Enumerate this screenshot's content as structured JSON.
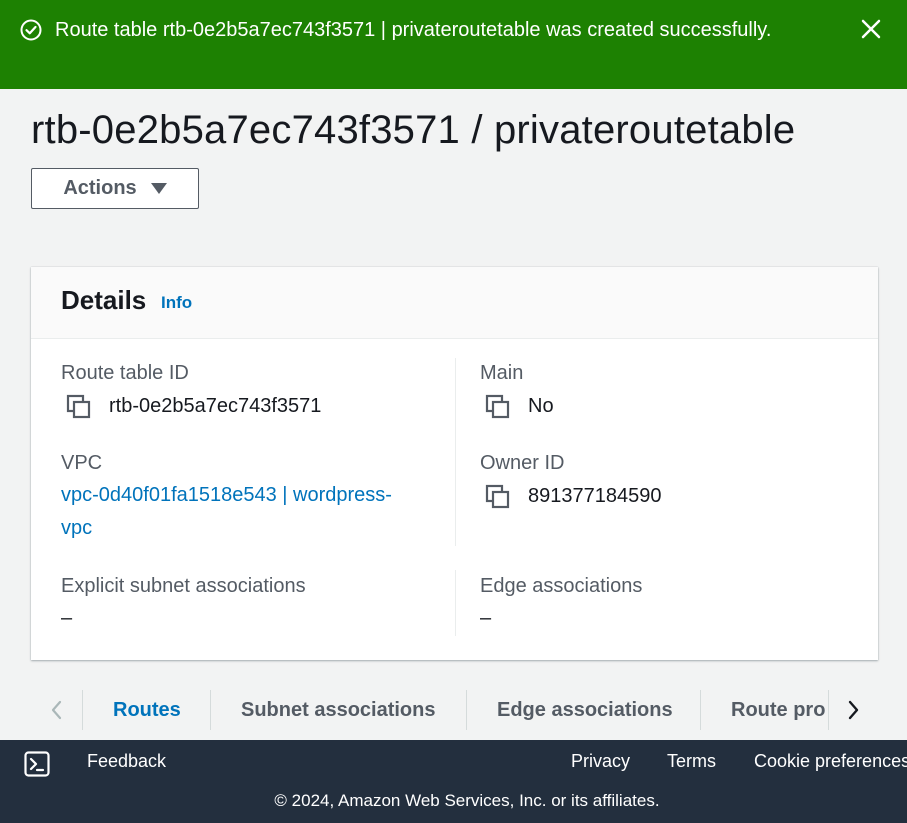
{
  "flash": {
    "message": "Route table rtb-0e2b5a7ec743f3571 | privateroutetable was created successfully.",
    "type": "success",
    "color": "#1d8102"
  },
  "page": {
    "title": "rtb-0e2b5a7ec743f3571 / privateroutetable",
    "actions_label": "Actions"
  },
  "details": {
    "title": "Details",
    "info_label": "Info",
    "route_table_id": {
      "label": "Route table ID",
      "value": "rtb-0e2b5a7ec743f3571"
    },
    "main": {
      "label": "Main",
      "value": "No"
    },
    "vpc": {
      "label": "VPC",
      "value_line1": "vpc-0d40f01fa1518e543 | wordpress-",
      "value_line2": "vpc"
    },
    "owner_id": {
      "label": "Owner ID",
      "value": "891377184590"
    },
    "explicit_subnet": {
      "label": "Explicit subnet associations",
      "value": "–"
    },
    "edge": {
      "label": "Edge associations",
      "value": "–"
    }
  },
  "tabs": [
    {
      "label": "Routes",
      "active": true
    },
    {
      "label": "Subnet associations",
      "active": false
    },
    {
      "label": "Edge associations",
      "active": false
    },
    {
      "label": "Route pro",
      "active": false
    }
  ],
  "footer": {
    "feedback": "Feedback",
    "privacy": "Privacy",
    "terms": "Terms",
    "cookies": "Cookie preferences",
    "copyright": "© 2024, Amazon Web Services, Inc. or its affiliates."
  },
  "colors": {
    "link": "#0073bb",
    "footer_bg": "#232f3e",
    "page_bg": "#f2f3f3"
  }
}
